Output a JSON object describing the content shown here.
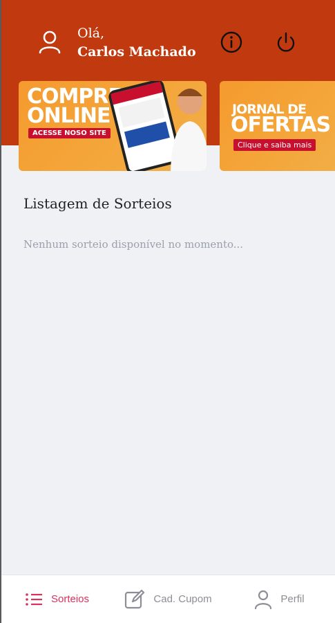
{
  "header": {
    "greeting": "Olá,",
    "user_name": "Carlos Machado",
    "icons": {
      "avatar": "user-icon",
      "info": "info-icon",
      "logout": "power-icon"
    },
    "color": "#c0390f"
  },
  "banners": [
    {
      "line1": "COMPRE",
      "line2": "ONLINE",
      "tag": "ACESSE NOSO SITE"
    },
    {
      "line1": "JORNAL DE",
      "line2": "OFERTAS",
      "tag": "Clique e saiba mais"
    }
  ],
  "main": {
    "title": "Listagem de Sorteios",
    "empty_message": "Nenhum sorteio disponível no momento..."
  },
  "tabbar": {
    "active_color": "#d6335a",
    "tabs": [
      {
        "label": "Sorteios",
        "icon": "list-icon",
        "active": true
      },
      {
        "label": "Cad. Cupom",
        "icon": "edit-icon",
        "active": false
      },
      {
        "label": "Perfil",
        "icon": "user-icon",
        "active": false
      }
    ]
  }
}
